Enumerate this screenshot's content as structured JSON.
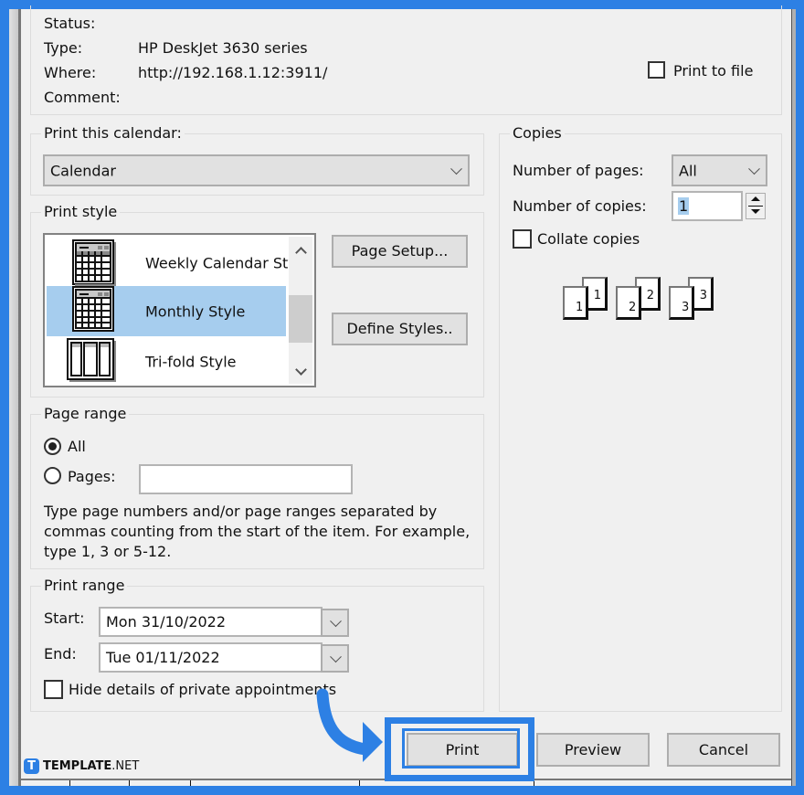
{
  "printer": {
    "status_label": "Status:",
    "status_value": "",
    "type_label": "Type:",
    "type_value": "HP DeskJet 3630 series",
    "where_label": "Where:",
    "where_value": "http://192.168.1.12:3911/",
    "comment_label": "Comment:",
    "comment_value": "",
    "print_to_file_label": "Print to file",
    "print_to_file_checked": false
  },
  "print_this_calendar": {
    "legend": "Print this calendar:",
    "selected": "Calendar"
  },
  "print_style": {
    "legend": "Print style",
    "items": [
      {
        "label": "Weekly Calendar Style",
        "icon": "weekly-calendar-icon",
        "selected": false
      },
      {
        "label": "Monthly Style",
        "icon": "monthly-calendar-icon",
        "selected": true
      },
      {
        "label": "Tri-fold Style",
        "icon": "trifold-icon",
        "selected": false
      }
    ],
    "page_setup_label": "Page Setup...",
    "define_styles_label": "Define Styles.."
  },
  "copies": {
    "legend": "Copies",
    "pages_label": "Number of pages:",
    "pages_value": "All",
    "copies_label": "Number of copies:",
    "copies_value": "1",
    "collate_label": "Collate copies",
    "collate_checked": false,
    "collate_pages": [
      "1",
      "1",
      "2",
      "2",
      "3",
      "3"
    ]
  },
  "page_range": {
    "legend": "Page range",
    "all_label": "All",
    "pages_label": "Pages:",
    "pages_value": "",
    "selected": "All",
    "hint": "Type page numbers and/or page ranges separated by commas counting from the start of the item.  For example, type 1, 3 or 5-12."
  },
  "print_range": {
    "legend": "Print range",
    "start_label": "Start:",
    "start_value": "Mon 31/10/2022",
    "end_label": "End:",
    "end_value": "Tue 01/11/2022",
    "hide_private_label": "Hide details of private appointments",
    "hide_private_checked": false
  },
  "buttons": {
    "print": "Print",
    "preview": "Preview",
    "cancel": "Cancel"
  },
  "watermark": {
    "brand_bold": "TEMPLATE",
    "brand_light": ".NET",
    "logo_letter": "T"
  },
  "colors": {
    "frame": "#2d80e4",
    "selection": "#a6cdee",
    "dialog_bg": "#f0f0f0"
  }
}
